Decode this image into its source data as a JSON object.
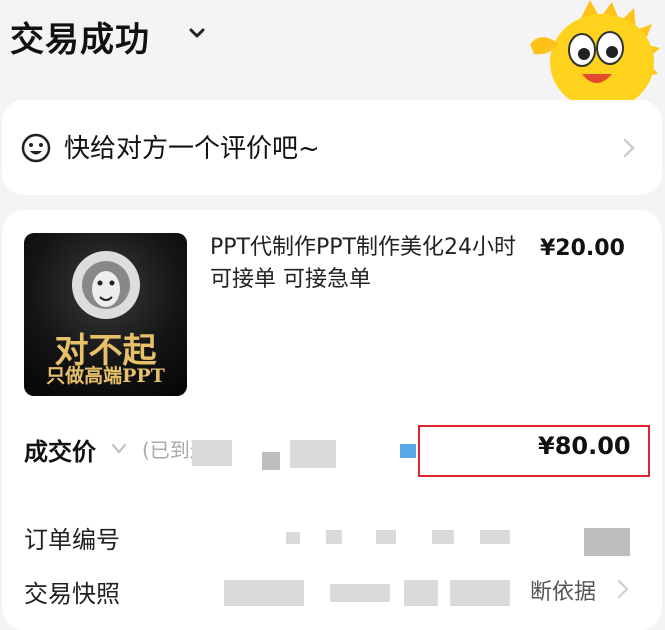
{
  "header": {
    "title": "交易成功"
  },
  "review": {
    "text": "快给对方一个评价吧~"
  },
  "product": {
    "title": "PPT代制作PPT制作美化24小时可接单 可接急单",
    "price": "¥20.00",
    "thumbnail_text_1": "对不起",
    "thumbnail_text_2": "只做高端PPT"
  },
  "deal": {
    "label": "成交价",
    "note": "(已到达",
    "price": "¥80.00"
  },
  "details": [
    {
      "label": "订单编号",
      "right": ""
    },
    {
      "label": "交易快照",
      "right": "断依据"
    }
  ],
  "colors": {
    "highlight": "#e0262d",
    "accent_yellow": "#ffd21e"
  },
  "icons": [
    "chevron-down-icon",
    "mascot-icon",
    "smiley-icon",
    "chevron-right-icon"
  ]
}
